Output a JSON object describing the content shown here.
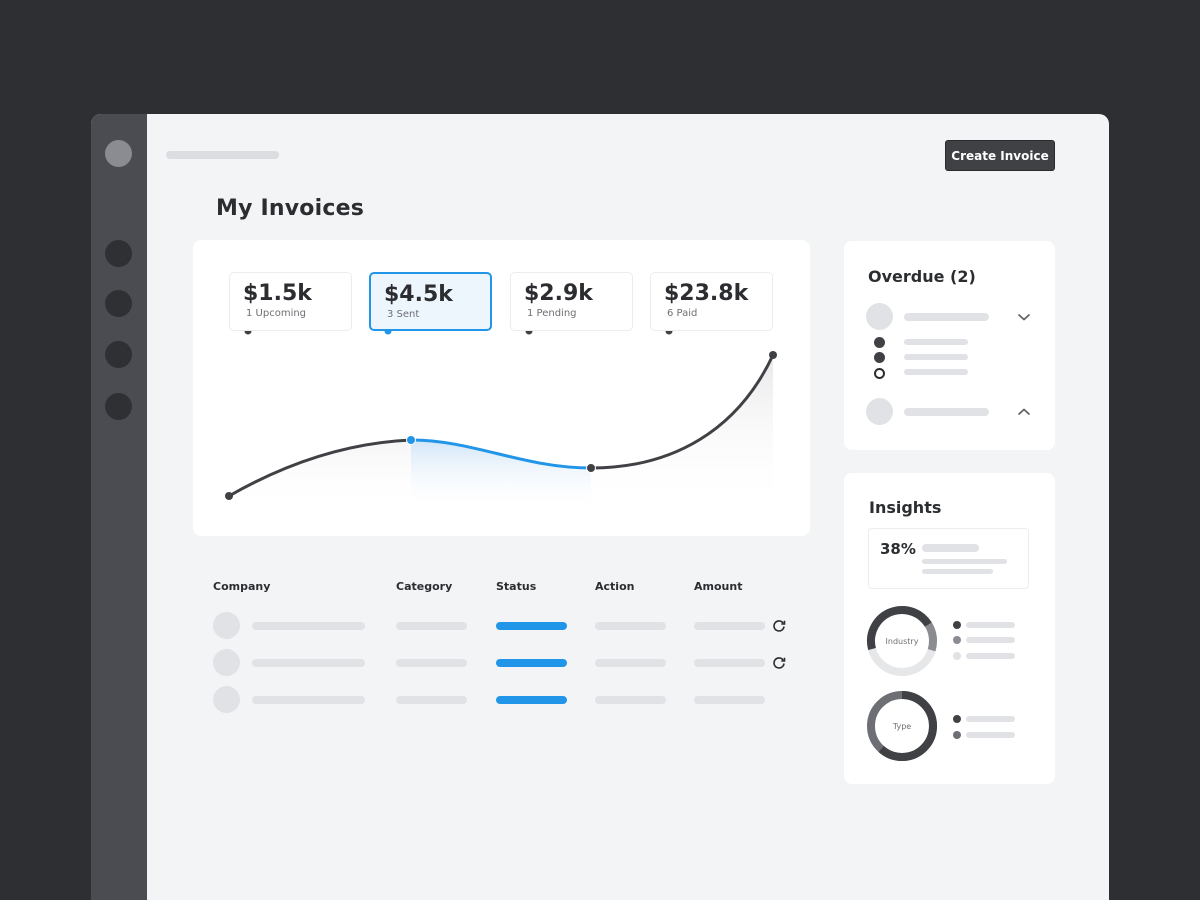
{
  "header": {
    "create_button_label": "Create Invoice",
    "page_title": "My Invoices"
  },
  "stats": [
    {
      "value": "$1.5k",
      "label": "1 Upcoming",
      "active": false
    },
    {
      "value": "$4.5k",
      "label": "3 Sent",
      "active": true
    },
    {
      "value": "$2.9k",
      "label": "1 Pending",
      "active": false
    },
    {
      "value": "$23.8k",
      "label": "6 Paid",
      "active": false
    }
  ],
  "table": {
    "columns": [
      "Company",
      "Category",
      "Status",
      "Action",
      "Amount"
    ],
    "rows": [
      {
        "has_refresh": true
      },
      {
        "has_refresh": true
      },
      {
        "has_refresh": false
      }
    ]
  },
  "overdue": {
    "title": "Overdue (2)"
  },
  "insights": {
    "title": "Insights",
    "percent": "38%",
    "donuts": [
      {
        "label": "Industry"
      },
      {
        "label": "Type"
      }
    ]
  },
  "colors": {
    "accent": "#2196e8",
    "dark": "#3f4145",
    "background": "#2e2f33"
  },
  "icons": {
    "refresh": "refresh-icon",
    "chevron_down": "chevron-down-icon",
    "chevron_up": "chevron-up-icon"
  }
}
